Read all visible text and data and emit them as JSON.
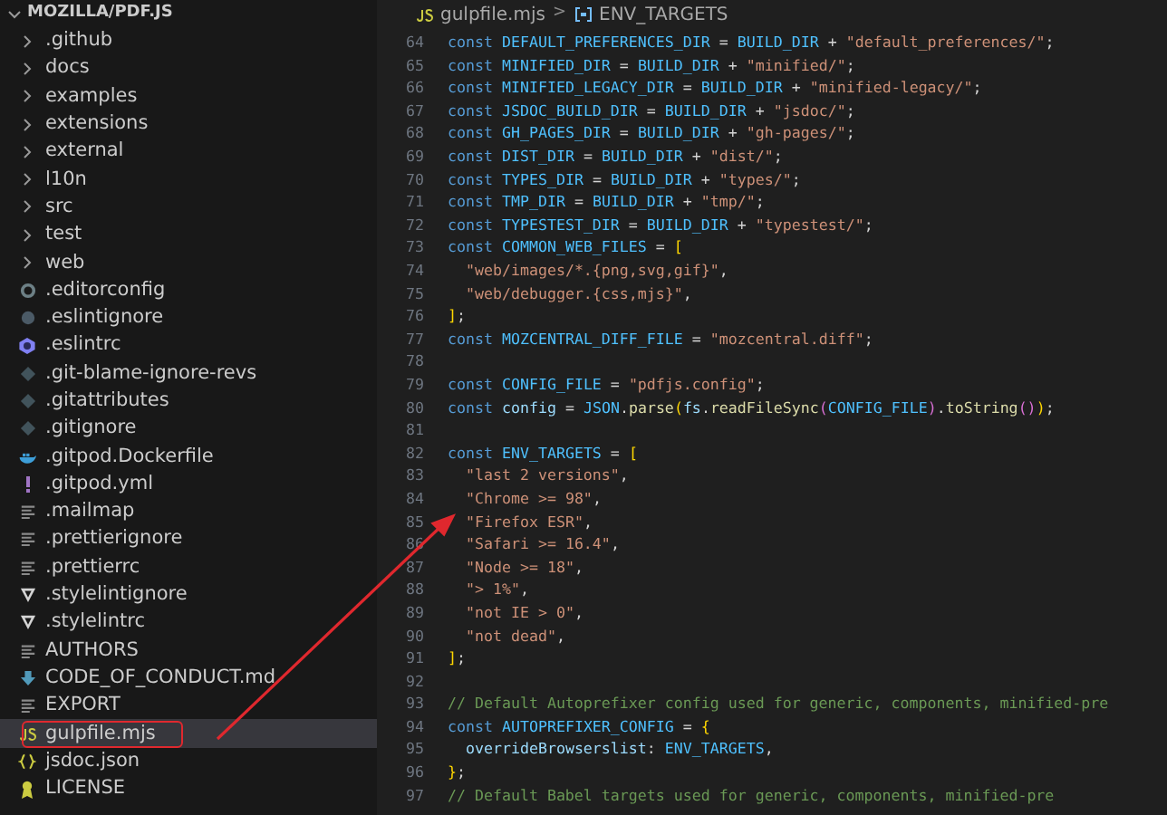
{
  "explorer": {
    "title": "MOZILLA/PDF.JS",
    "expanded": true,
    "items": [
      {
        "label": ".github",
        "kind": "folder",
        "expanded": false,
        "selected": false,
        "highlighted": false
      },
      {
        "label": "docs",
        "kind": "folder",
        "expanded": false,
        "selected": false,
        "highlighted": false
      },
      {
        "label": "examples",
        "kind": "folder",
        "expanded": false,
        "selected": false,
        "highlighted": false
      },
      {
        "label": "extensions",
        "kind": "folder",
        "expanded": false,
        "selected": false,
        "highlighted": false
      },
      {
        "label": "external",
        "kind": "folder",
        "expanded": false,
        "selected": false,
        "highlighted": false
      },
      {
        "label": "l10n",
        "kind": "folder",
        "expanded": false,
        "selected": false,
        "highlighted": false
      },
      {
        "label": "src",
        "kind": "folder",
        "expanded": false,
        "selected": false,
        "highlighted": false
      },
      {
        "label": "test",
        "kind": "folder",
        "expanded": false,
        "selected": false,
        "highlighted": false
      },
      {
        "label": "web",
        "kind": "folder",
        "expanded": false,
        "selected": false,
        "highlighted": false
      },
      {
        "label": ".editorconfig",
        "kind": "gear",
        "selected": false,
        "highlighted": false
      },
      {
        "label": ".eslintignore",
        "kind": "circle",
        "selected": false,
        "highlighted": false
      },
      {
        "label": ".eslintrc",
        "kind": "eslint",
        "selected": false,
        "highlighted": false
      },
      {
        "label": ".git-blame-ignore-revs",
        "kind": "git",
        "selected": false,
        "highlighted": false
      },
      {
        "label": ".gitattributes",
        "kind": "git",
        "selected": false,
        "highlighted": false
      },
      {
        "label": ".gitignore",
        "kind": "git",
        "selected": false,
        "highlighted": false
      },
      {
        "label": ".gitpod.Dockerfile",
        "kind": "docker",
        "selected": false,
        "highlighted": false
      },
      {
        "label": ".gitpod.yml",
        "kind": "yaml",
        "selected": false,
        "highlighted": false
      },
      {
        "label": ".mailmap",
        "kind": "text",
        "selected": false,
        "highlighted": false
      },
      {
        "label": ".prettierignore",
        "kind": "text",
        "selected": false,
        "highlighted": false
      },
      {
        "label": ".prettierrc",
        "kind": "text",
        "selected": false,
        "highlighted": false
      },
      {
        "label": ".stylelintignore",
        "kind": "stylelint",
        "selected": false,
        "highlighted": false
      },
      {
        "label": ".stylelintrc",
        "kind": "stylelint",
        "selected": false,
        "highlighted": false
      },
      {
        "label": "AUTHORS",
        "kind": "text",
        "selected": false,
        "highlighted": false
      },
      {
        "label": "CODE_OF_CONDUCT.md",
        "kind": "markdown",
        "selected": false,
        "highlighted": false
      },
      {
        "label": "EXPORT",
        "kind": "text",
        "selected": false,
        "highlighted": false
      },
      {
        "label": "gulpfile.mjs",
        "kind": "js",
        "selected": true,
        "highlighted": true
      },
      {
        "label": "jsdoc.json",
        "kind": "json",
        "selected": false,
        "highlighted": false
      },
      {
        "label": "LICENSE",
        "kind": "license",
        "selected": false,
        "highlighted": false
      }
    ]
  },
  "breadcrumb": [
    {
      "label": "gulpfile.mjs",
      "kind": "js"
    },
    {
      "label": "ENV_TARGETS",
      "kind": "symbol"
    }
  ],
  "breadcrumb_separator": ">",
  "code": [
    {
      "n": "64",
      "t": [
        {
          "kind": "keyword",
          "text": "const "
        },
        {
          "kind": "constant",
          "text": "DEFAULT_PREFERENCES_DIR"
        },
        {
          "kind": "plain",
          "text": " = "
        },
        {
          "kind": "constant",
          "text": "BUILD_DIR"
        },
        {
          "kind": "plain",
          "text": " + "
        },
        {
          "kind": "string",
          "text": "\"default_preferences/\""
        },
        {
          "kind": "plain",
          "text": ";"
        }
      ]
    },
    {
      "n": "65",
      "t": [
        {
          "kind": "keyword",
          "text": "const "
        },
        {
          "kind": "constant",
          "text": "MINIFIED_DIR"
        },
        {
          "kind": "plain",
          "text": " = "
        },
        {
          "kind": "constant",
          "text": "BUILD_DIR"
        },
        {
          "kind": "plain",
          "text": " + "
        },
        {
          "kind": "string",
          "text": "\"minified/\""
        },
        {
          "kind": "plain",
          "text": ";"
        }
      ]
    },
    {
      "n": "66",
      "t": [
        {
          "kind": "keyword",
          "text": "const "
        },
        {
          "kind": "constant",
          "text": "MINIFIED_LEGACY_DIR"
        },
        {
          "kind": "plain",
          "text": " = "
        },
        {
          "kind": "constant",
          "text": "BUILD_DIR"
        },
        {
          "kind": "plain",
          "text": " + "
        },
        {
          "kind": "string",
          "text": "\"minified-legacy/\""
        },
        {
          "kind": "plain",
          "text": ";"
        }
      ]
    },
    {
      "n": "67",
      "t": [
        {
          "kind": "keyword",
          "text": "const "
        },
        {
          "kind": "constant",
          "text": "JSDOC_BUILD_DIR"
        },
        {
          "kind": "plain",
          "text": " = "
        },
        {
          "kind": "constant",
          "text": "BUILD_DIR"
        },
        {
          "kind": "plain",
          "text": " + "
        },
        {
          "kind": "string",
          "text": "\"jsdoc/\""
        },
        {
          "kind": "plain",
          "text": ";"
        }
      ]
    },
    {
      "n": "68",
      "t": [
        {
          "kind": "keyword",
          "text": "const "
        },
        {
          "kind": "constant",
          "text": "GH_PAGES_DIR"
        },
        {
          "kind": "plain",
          "text": " = "
        },
        {
          "kind": "constant",
          "text": "BUILD_DIR"
        },
        {
          "kind": "plain",
          "text": " + "
        },
        {
          "kind": "string",
          "text": "\"gh-pages/\""
        },
        {
          "kind": "plain",
          "text": ";"
        }
      ]
    },
    {
      "n": "69",
      "t": [
        {
          "kind": "keyword",
          "text": "const "
        },
        {
          "kind": "constant",
          "text": "DIST_DIR"
        },
        {
          "kind": "plain",
          "text": " = "
        },
        {
          "kind": "constant",
          "text": "BUILD_DIR"
        },
        {
          "kind": "plain",
          "text": " + "
        },
        {
          "kind": "string",
          "text": "\"dist/\""
        },
        {
          "kind": "plain",
          "text": ";"
        }
      ]
    },
    {
      "n": "70",
      "t": [
        {
          "kind": "keyword",
          "text": "const "
        },
        {
          "kind": "constant",
          "text": "TYPES_DIR"
        },
        {
          "kind": "plain",
          "text": " = "
        },
        {
          "kind": "constant",
          "text": "BUILD_DIR"
        },
        {
          "kind": "plain",
          "text": " + "
        },
        {
          "kind": "string",
          "text": "\"types/\""
        },
        {
          "kind": "plain",
          "text": ";"
        }
      ]
    },
    {
      "n": "71",
      "t": [
        {
          "kind": "keyword",
          "text": "const "
        },
        {
          "kind": "constant",
          "text": "TMP_DIR"
        },
        {
          "kind": "plain",
          "text": " = "
        },
        {
          "kind": "constant",
          "text": "BUILD_DIR"
        },
        {
          "kind": "plain",
          "text": " + "
        },
        {
          "kind": "string",
          "text": "\"tmp/\""
        },
        {
          "kind": "plain",
          "text": ";"
        }
      ]
    },
    {
      "n": "72",
      "t": [
        {
          "kind": "keyword",
          "text": "const "
        },
        {
          "kind": "constant",
          "text": "TYPESTEST_DIR"
        },
        {
          "kind": "plain",
          "text": " = "
        },
        {
          "kind": "constant",
          "text": "BUILD_DIR"
        },
        {
          "kind": "plain",
          "text": " + "
        },
        {
          "kind": "string",
          "text": "\"typestest/\""
        },
        {
          "kind": "plain",
          "text": ";"
        }
      ]
    },
    {
      "n": "73",
      "t": [
        {
          "kind": "keyword",
          "text": "const "
        },
        {
          "kind": "constant",
          "text": "COMMON_WEB_FILES"
        },
        {
          "kind": "plain",
          "text": " = "
        },
        {
          "kind": "bracket",
          "text": "["
        }
      ]
    },
    {
      "n": "74",
      "indent": true,
      "t": [
        {
          "kind": "string",
          "text": "\"web/images/*.{png,svg,gif}\""
        },
        {
          "kind": "plain",
          "text": ","
        }
      ]
    },
    {
      "n": "75",
      "indent": true,
      "t": [
        {
          "kind": "string",
          "text": "\"web/debugger.{css,mjs}\""
        },
        {
          "kind": "plain",
          "text": ","
        }
      ]
    },
    {
      "n": "76",
      "t": [
        {
          "kind": "bracket",
          "text": "]"
        },
        {
          "kind": "plain",
          "text": ";"
        }
      ]
    },
    {
      "n": "77",
      "t": [
        {
          "kind": "keyword",
          "text": "const "
        },
        {
          "kind": "constant",
          "text": "MOZCENTRAL_DIFF_FILE"
        },
        {
          "kind": "plain",
          "text": " = "
        },
        {
          "kind": "string",
          "text": "\"mozcentral.diff\""
        },
        {
          "kind": "plain",
          "text": ";"
        }
      ]
    },
    {
      "n": "78"
    },
    {
      "n": "79",
      "t": [
        {
          "kind": "keyword",
          "text": "const "
        },
        {
          "kind": "constant",
          "text": "CONFIG_FILE"
        },
        {
          "kind": "plain",
          "text": " = "
        },
        {
          "kind": "string",
          "text": "\"pdfjs.config\""
        },
        {
          "kind": "plain",
          "text": ";"
        }
      ]
    },
    {
      "n": "80",
      "t": [
        {
          "kind": "keyword",
          "text": "const "
        },
        {
          "kind": "variable",
          "text": "config"
        },
        {
          "kind": "plain",
          "text": " = "
        },
        {
          "kind": "constant",
          "text": "JSON"
        },
        {
          "kind": "plain",
          "text": "."
        },
        {
          "kind": "function",
          "text": "parse"
        },
        {
          "kind": "bracket",
          "text": "("
        },
        {
          "kind": "variable",
          "text": "fs"
        },
        {
          "kind": "plain",
          "text": "."
        },
        {
          "kind": "function",
          "text": "readFileSync"
        },
        {
          "kind": "paren",
          "text": "("
        },
        {
          "kind": "constant",
          "text": "CONFIG_FILE"
        },
        {
          "kind": "paren",
          "text": ")"
        },
        {
          "kind": "plain",
          "text": "."
        },
        {
          "kind": "function",
          "text": "toString"
        },
        {
          "kind": "paren",
          "text": "()"
        },
        {
          "kind": "bracket",
          "text": ")"
        },
        {
          "kind": "plain",
          "text": ";"
        }
      ]
    },
    {
      "n": "81"
    },
    {
      "n": "82",
      "t": [
        {
          "kind": "keyword",
          "text": "const "
        },
        {
          "kind": "constant",
          "text": "ENV_TARGETS"
        },
        {
          "kind": "plain",
          "text": " = "
        },
        {
          "kind": "bracket",
          "text": "["
        }
      ]
    },
    {
      "n": "83",
      "indent": true,
      "t": [
        {
          "kind": "string",
          "text": "\"last 2 versions\""
        },
        {
          "kind": "plain",
          "text": ","
        }
      ]
    },
    {
      "n": "84",
      "indent": true,
      "t": [
        {
          "kind": "string",
          "text": "\"Chrome >= 98\""
        },
        {
          "kind": "plain",
          "text": ","
        }
      ]
    },
    {
      "n": "85",
      "indent": true,
      "t": [
        {
          "kind": "string",
          "text": "\"Firefox ESR\""
        },
        {
          "kind": "plain",
          "text": ","
        }
      ]
    },
    {
      "n": "86",
      "indent": true,
      "t": [
        {
          "kind": "string",
          "text": "\"Safari >= 16.4\""
        },
        {
          "kind": "plain",
          "text": ","
        }
      ]
    },
    {
      "n": "87",
      "indent": true,
      "t": [
        {
          "kind": "string",
          "text": "\"Node >= 18\""
        },
        {
          "kind": "plain",
          "text": ","
        }
      ]
    },
    {
      "n": "88",
      "indent": true,
      "t": [
        {
          "kind": "string",
          "text": "\"> 1%\""
        },
        {
          "kind": "plain",
          "text": ","
        }
      ]
    },
    {
      "n": "89",
      "indent": true,
      "t": [
        {
          "kind": "string",
          "text": "\"not IE > 0\""
        },
        {
          "kind": "plain",
          "text": ","
        }
      ]
    },
    {
      "n": "90",
      "indent": true,
      "t": [
        {
          "kind": "string",
          "text": "\"not dead\""
        },
        {
          "kind": "plain",
          "text": ","
        }
      ]
    },
    {
      "n": "91",
      "t": [
        {
          "kind": "bracket",
          "text": "]"
        },
        {
          "kind": "plain",
          "text": ";"
        }
      ]
    },
    {
      "n": "92"
    },
    {
      "n": "93",
      "t": [
        {
          "kind": "comment",
          "text": "// Default Autoprefixer config used for generic, components, minified-pre"
        }
      ]
    },
    {
      "n": "94",
      "t": [
        {
          "kind": "keyword",
          "text": "const "
        },
        {
          "kind": "constant",
          "text": "AUTOPREFIXER_CONFIG"
        },
        {
          "kind": "plain",
          "text": " = "
        },
        {
          "kind": "bracket",
          "text": "{"
        }
      ]
    },
    {
      "n": "95",
      "indent": true,
      "t": [
        {
          "kind": "variable",
          "text": "overrideBrowserslist"
        },
        {
          "kind": "plain",
          "text": ": "
        },
        {
          "kind": "constant",
          "text": "ENV_TARGETS"
        },
        {
          "kind": "plain",
          "text": ","
        }
      ]
    },
    {
      "n": "96",
      "t": [
        {
          "kind": "bracket",
          "text": "}"
        },
        {
          "kind": "plain",
          "text": ";"
        }
      ]
    },
    {
      "n": "97",
      "t": [
        {
          "kind": "comment",
          "text": "// Default Babel targets used for generic, components, minified-pre"
        }
      ]
    }
  ]
}
